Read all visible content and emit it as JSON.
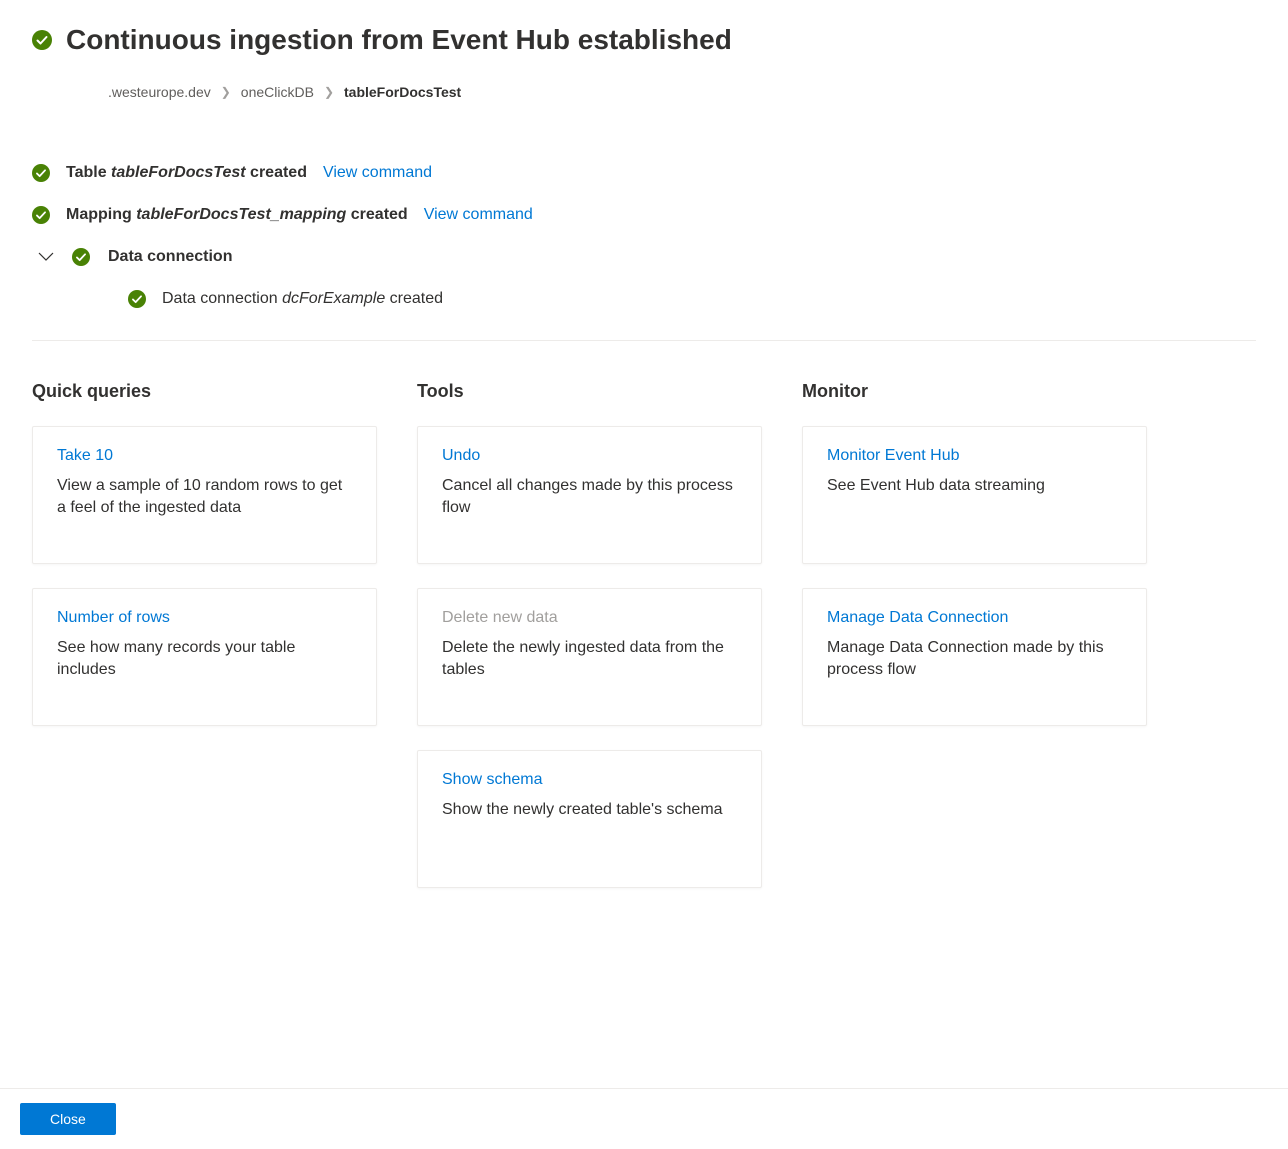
{
  "header": {
    "title": "Continuous ingestion from Event Hub established"
  },
  "breadcrumb": {
    "items": [
      ".westeurope.dev",
      "oneClickDB",
      "tableForDocsTest"
    ]
  },
  "status": {
    "table": {
      "prefix": "Table ",
      "name": "tableForDocsTest",
      "suffix": " created",
      "link": "View command"
    },
    "mapping": {
      "prefix": "Mapping ",
      "name": "tableForDocsTest_mapping",
      "suffix": " created",
      "link": "View command"
    },
    "connection": {
      "label": "Data connection",
      "sub": {
        "prefix": "Data connection ",
        "name": "dcForExample",
        "suffix": " created"
      }
    }
  },
  "sections": {
    "quick_queries": {
      "title": "Quick queries",
      "cards": [
        {
          "title": "Take 10",
          "desc": "View a sample of 10 random rows to get a feel of the ingested data",
          "disabled": false
        },
        {
          "title": "Number of rows",
          "desc": "See how many records your table includes",
          "disabled": false
        }
      ]
    },
    "tools": {
      "title": "Tools",
      "cards": [
        {
          "title": "Undo",
          "desc": "Cancel all changes made by this process flow",
          "disabled": false
        },
        {
          "title": "Delete new data",
          "desc": "Delete the newly ingested data from the tables",
          "disabled": true
        },
        {
          "title": "Show schema",
          "desc": "Show the newly created table's schema",
          "disabled": false
        }
      ]
    },
    "monitor": {
      "title": "Monitor",
      "cards": [
        {
          "title": "Monitor Event Hub",
          "desc": "See Event Hub data streaming",
          "disabled": false
        },
        {
          "title": "Manage Data Connection",
          "desc": "Manage Data Connection made by this process flow",
          "disabled": false
        }
      ]
    }
  },
  "footer": {
    "close": "Close"
  }
}
